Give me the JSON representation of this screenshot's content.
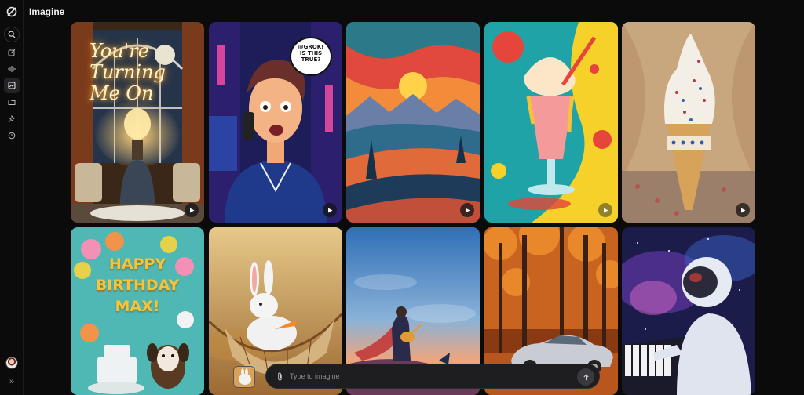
{
  "app": {
    "title": "Imagine"
  },
  "sidebar": {
    "items": [
      {
        "name": "search",
        "icon": "search-icon"
      },
      {
        "name": "new-chat",
        "icon": "edit-icon"
      },
      {
        "name": "voice",
        "icon": "waveform-icon"
      },
      {
        "name": "imagine",
        "icon": "image-icon",
        "active": true
      },
      {
        "name": "projects",
        "icon": "folder-icon"
      },
      {
        "name": "pinned",
        "icon": "pin-icon"
      },
      {
        "name": "history",
        "icon": "history-icon"
      }
    ],
    "expand_glyph": "»"
  },
  "gallery": {
    "row1": [
      {
        "id": "lamp",
        "overlay_lines": [
          "You're",
          "Turning",
          "Me On"
        ],
        "has_play": true
      },
      {
        "id": "comic",
        "bubble_lines": [
          "@GROK!",
          "IS THIS",
          "TRUE?"
        ],
        "has_play": true
      },
      {
        "id": "sunset",
        "has_play": true
      },
      {
        "id": "sundae",
        "has_play": true
      },
      {
        "id": "cone",
        "has_play": true
      }
    ],
    "row2": [
      {
        "id": "birthday",
        "overlay_lines": [
          "HAPPY",
          "BIRTHDAY",
          "MAX!"
        ]
      },
      {
        "id": "bunny"
      },
      {
        "id": "guitar"
      },
      {
        "id": "car"
      },
      {
        "id": "astronaut"
      }
    ]
  },
  "prompt": {
    "placeholder": "Type to imagine"
  },
  "colors": {
    "bg": "#0b0b0c",
    "accent": "#f2f2f2"
  }
}
